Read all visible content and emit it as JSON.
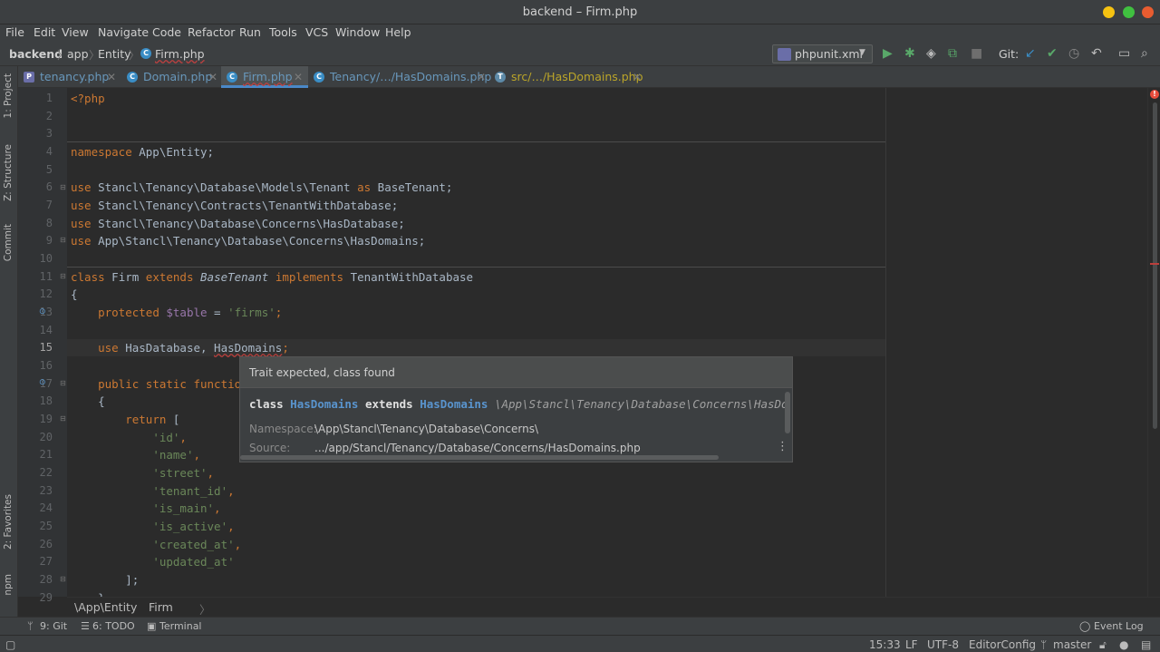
{
  "window": {
    "title": "backend – Firm.php"
  },
  "menu": [
    "File",
    "Edit",
    "View",
    "Navigate",
    "Code",
    "Refactor",
    "Run",
    "Tools",
    "VCS",
    "Window",
    "Help"
  ],
  "breadcrumb": {
    "project": "backend",
    "dir1": "app",
    "dir2": "Entity",
    "file": "Firm.php"
  },
  "run_config": {
    "label": "phpunit.xml"
  },
  "git_label": "Git:",
  "tabs": [
    {
      "label": "tenancy.php",
      "active": false
    },
    {
      "label": "Domain.php",
      "active": false
    },
    {
      "label": "Firm.php",
      "active": true
    },
    {
      "label": "Tenancy/…/HasDomains.php",
      "active": false
    },
    {
      "label": "src/…/HasDomains.php",
      "active": false
    }
  ],
  "side_tabs": {
    "project": "1: Project",
    "structure": "Z: Structure",
    "commit": "Commit",
    "favorites": "2: Favorites",
    "npm": "npm"
  },
  "line_numbers": [
    "1",
    "2",
    "3",
    "4",
    "5",
    "6",
    "7",
    "8",
    "9",
    "10",
    "11",
    "12",
    "13",
    "14",
    "15",
    "16",
    "17",
    "18",
    "19",
    "20",
    "21",
    "22",
    "23",
    "24",
    "25",
    "26",
    "27",
    "28",
    "29"
  ],
  "code": {
    "l1": "<?php",
    "l4_kw": "namespace",
    "l4_rest": " App\\Entity;",
    "use_kw": "use",
    "l6_ns": " Stancl\\Tenancy\\Database\\Models\\Tenant ",
    "l6_as": "as",
    "l6_alias": " BaseTenant;",
    "l7": " Stancl\\Tenancy\\Contracts\\TenantWithDatabase;",
    "l8": " Stancl\\Tenancy\\Database\\Concerns\\HasDatabase;",
    "l9": " App\\Stancl\\Tenancy\\Database\\Concerns\\HasDomains;",
    "l11_class": "class",
    "l11_name": " Firm ",
    "l11_extends": "extends",
    "l11_base": "BaseTenant",
    "l11_impl": "implements",
    "l11_iface": " TenantWithDatabase",
    "l12": "{",
    "l13_prot": "protected",
    "l13_var": "$table",
    "l13_eq": " = ",
    "l13_str": "'firms'",
    "l13_end": ";",
    "l15_use": "use",
    "l15_rest1": " HasDatabase, ",
    "l15_err": "HasDomains",
    "l15_end": ";",
    "l17_kw": "public static functio",
    "l18": "{",
    "l19_ret": "return",
    "l19_rest": " [",
    "l20": "'id'",
    "l21": "'name'",
    "l22": "'street'",
    "l23": "'tenant_id'",
    "l24": "'is_main'",
    "l25": "'is_active'",
    "l26": "'created_at'",
    "l27": "'updated_at'",
    "comma": ",",
    "l28": "];",
    "l29": "}"
  },
  "popup": {
    "header": "Trait expected, class found",
    "decl_class": "class",
    "decl_name": "HasDomains",
    "decl_extends": "extends",
    "decl_name2": "HasDomains",
    "decl_path": "\\App\\Stancl\\Tenancy\\Database\\Concerns\\HasDom",
    "ns_label": "Namespace:",
    "ns_value": "\\App\\Stancl\\Tenancy\\Database\\Concerns\\",
    "src_label": "Source:",
    "src_value": ".../app/Stancl/Tenancy/Database/Concerns/HasDomains.php"
  },
  "editor_breadcrumb": {
    "ns": "\\App\\Entity",
    "cls": "Firm"
  },
  "bottom_tools": {
    "git": "9: Git",
    "todo": "6: TODO",
    "terminal": "Terminal",
    "event_log": "Event Log"
  },
  "status": {
    "position": "15:33",
    "line_sep": "LF",
    "encoding": "UTF-8",
    "editorconfig": "EditorConfig",
    "branch": "master"
  },
  "colors": {
    "accent": "#3a8dc5",
    "error": "#e74c3c",
    "string": "#6a8759",
    "keyword": "#cc7832"
  }
}
